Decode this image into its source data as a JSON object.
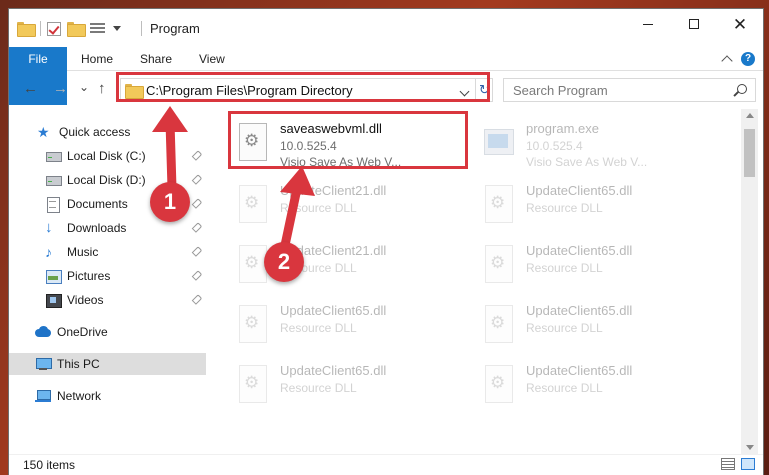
{
  "window": {
    "title": "Program",
    "controls": {
      "minimize": "–",
      "maximize": "□",
      "close": "✕"
    }
  },
  "ribbon": {
    "tabs": [
      "File",
      "Home",
      "Share",
      "View"
    ]
  },
  "nav": {
    "address": "C:\\Program Files\\Program Directory",
    "search_placeholder": "Search Program",
    "back": "←",
    "forward": "→",
    "recent": "⌄",
    "up": "↑",
    "refresh": "↻"
  },
  "sidebar": {
    "items": [
      {
        "label": "Quick access",
        "icon": "star-icon",
        "pinned": false
      },
      {
        "label": "Local Disk (C:)",
        "icon": "disk-icon",
        "pinned": true
      },
      {
        "label": "Local Disk (D:)",
        "icon": "disk-icon",
        "pinned": true
      },
      {
        "label": "Documents",
        "icon": "documents-icon",
        "pinned": true
      },
      {
        "label": "Downloads",
        "icon": "download-icon",
        "pinned": true
      },
      {
        "label": "Music",
        "icon": "music-icon",
        "pinned": true
      },
      {
        "label": "Pictures",
        "icon": "pictures-icon",
        "pinned": true
      },
      {
        "label": "Videos",
        "icon": "videos-icon",
        "pinned": true
      },
      {
        "label": "OneDrive",
        "icon": "cloud-icon",
        "pinned": false
      },
      {
        "label": "This PC",
        "icon": "computer-icon",
        "pinned": false,
        "selected": true
      },
      {
        "label": "Network",
        "icon": "network-icon",
        "pinned": false
      }
    ]
  },
  "files": [
    {
      "name": "saveaswebvml.dll",
      "line1": "10.0.525.4",
      "line2": "Visio Save As Web V...",
      "icon": "dll-icon",
      "highlighted": true
    },
    {
      "name": "program.exe",
      "line1": "10.0.525.4",
      "line2": "Visio Save As Web V...",
      "icon": "exe-icon",
      "highlighted": false
    },
    {
      "name": "UpdateClient21.dll",
      "line1": "Resource DLL",
      "line2": "",
      "icon": "dll-icon",
      "highlighted": false
    },
    {
      "name": "UpdateClient65.dll",
      "line1": "Resource DLL",
      "line2": "",
      "icon": "dll-icon",
      "highlighted": false
    },
    {
      "name": "UpdateClient21.dll",
      "line1": "Resource DLL",
      "line2": "",
      "icon": "dll-icon",
      "highlighted": false
    },
    {
      "name": "UpdateClient65.dll",
      "line1": "Resource DLL",
      "line2": "",
      "icon": "dll-icon",
      "highlighted": false
    },
    {
      "name": "UpdateClient65.dll",
      "line1": "Resource DLL",
      "line2": "",
      "icon": "dll-icon",
      "highlighted": false
    },
    {
      "name": "UpdateClient65.dll",
      "line1": "Resource DLL",
      "line2": "",
      "icon": "dll-icon",
      "highlighted": false
    },
    {
      "name": "UpdateClient65.dll",
      "line1": "Resource DLL",
      "line2": "",
      "icon": "dll-icon",
      "highlighted": false
    },
    {
      "name": "UpdateClient65.dll",
      "line1": "Resource DLL",
      "line2": "",
      "icon": "dll-icon",
      "highlighted": false
    }
  ],
  "status": {
    "item_count": "150 items"
  },
  "annotations": {
    "callout_1": "1",
    "callout_2": "2",
    "color": "#d9363e"
  },
  "colors": {
    "accent": "#1979ca",
    "selected_bg": "#dddddd"
  }
}
